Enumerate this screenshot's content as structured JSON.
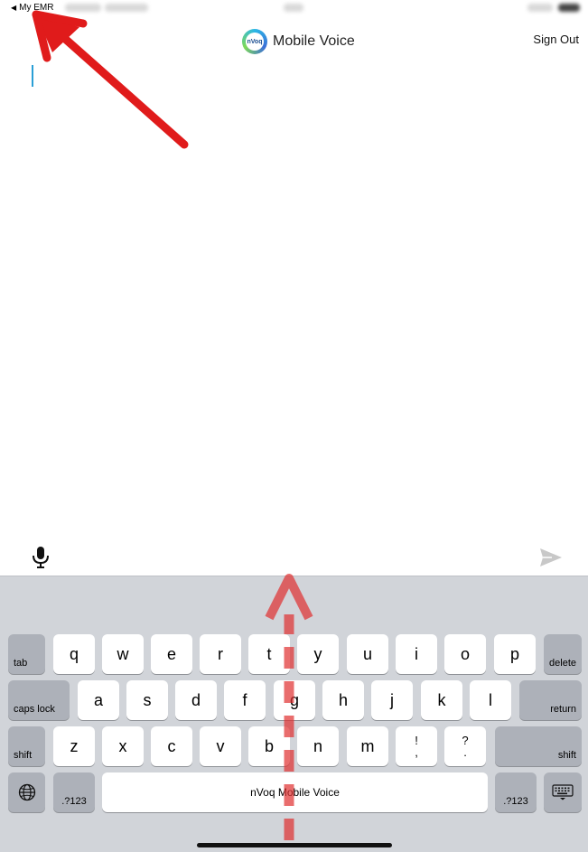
{
  "status_bar": {
    "back_label": "My EMR"
  },
  "nav": {
    "title": "Mobile Voice",
    "logo_text": "nVoq",
    "sign_out": "Sign Out"
  },
  "compose": {
    "mic_icon": "microphone-icon",
    "send_icon": "send-icon"
  },
  "keyboard": {
    "row1": [
      "q",
      "w",
      "e",
      "r",
      "t",
      "y",
      "u",
      "i",
      "o",
      "p"
    ],
    "row2": [
      "a",
      "s",
      "d",
      "f",
      "g",
      "h",
      "j",
      "k",
      "l"
    ],
    "row3": [
      "z",
      "x",
      "c",
      "v",
      "b",
      "n",
      "m"
    ],
    "punct1": {
      "top": "!",
      "bottom": ","
    },
    "punct2": {
      "top": "?",
      "bottom": "."
    },
    "tab": "tab",
    "delete": "delete",
    "caps_lock": "caps lock",
    "return": "return",
    "shift_left": "shift",
    "shift_right": "shift",
    "numbers_left": ".?123",
    "numbers_right": ".?123",
    "space": "nVoq Mobile Voice",
    "globe_icon": "globe-icon",
    "hide_keyboard_icon": "keyboard-dismiss-icon"
  },
  "colors": {
    "keyboard_bg": "#d1d4d9",
    "key_bg": "#ffffff",
    "fn_key_bg": "#adb1b9",
    "caret": "#2a9fd6",
    "annotation": "#e01b1b"
  }
}
